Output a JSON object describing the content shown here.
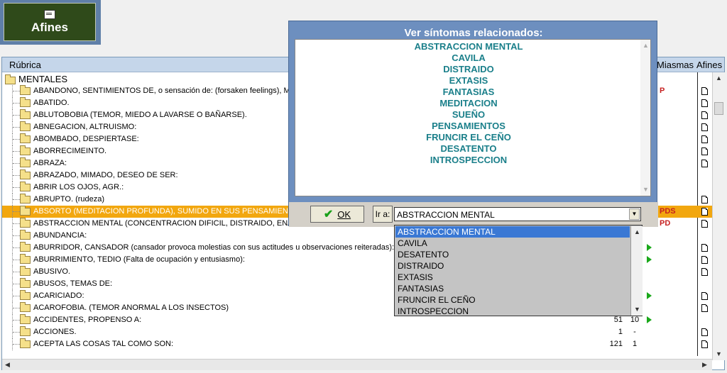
{
  "toolbar": {
    "afines_label": "Afines",
    "afines_icon": "document-icon"
  },
  "table": {
    "headers": {
      "rubrica": "Rúbrica",
      "miasmas": "Miasmas",
      "afines": "Afines"
    },
    "root": "MENTALES",
    "rows": [
      {
        "label": "ABANDONO, SENTIMIENTOS DE, o sensación de: (forsaken feelings), Mias",
        "n1": "",
        "n2": "",
        "miasma": "P",
        "doc": true,
        "arrow": false
      },
      {
        "label": "ABATIDO.",
        "n1": "",
        "n2": "",
        "miasma": "",
        "doc": true,
        "arrow": false
      },
      {
        "label": "ABLUTOBOBIA (TEMOR, MIEDO A LAVARSE O BAÑARSE).",
        "n1": "",
        "n2": "",
        "miasma": "",
        "doc": true,
        "arrow": false
      },
      {
        "label": "ABNEGACION, ALTRUISMO:",
        "n1": "",
        "n2": "",
        "miasma": "",
        "doc": true,
        "arrow": false
      },
      {
        "label": "ABOMBADO, DESPIERTASE:",
        "n1": "",
        "n2": "",
        "miasma": "",
        "doc": true,
        "arrow": false
      },
      {
        "label": "ABORRECIMEINTO.",
        "n1": "",
        "n2": "",
        "miasma": "",
        "doc": true,
        "arrow": false
      },
      {
        "label": "ABRAZA:",
        "n1": "",
        "n2": "",
        "miasma": "",
        "doc": true,
        "arrow": false
      },
      {
        "label": "ABRAZADO, MIMADO, DESEO DE SER:",
        "n1": "",
        "n2": "",
        "miasma": "",
        "doc": false,
        "arrow": false
      },
      {
        "label": "ABRIR LOS OJOS, AGR.:",
        "n1": "",
        "n2": "",
        "miasma": "",
        "doc": false,
        "arrow": false
      },
      {
        "label": "ABRUPTO. (rudeza)",
        "n1": "",
        "n2": "",
        "miasma": "",
        "doc": true,
        "arrow": false
      },
      {
        "label": "ABSORTO (MEDITACION PROFUNDA), SUMIDO EN SUS PENSAMIENTOS (b",
        "n1": "",
        "n2": "",
        "miasma": "PDS",
        "doc": true,
        "arrow": false,
        "selected": true
      },
      {
        "label": "ABSTRACCION MENTAL (CONCENTRACION DIFICIL, DISTRAIDO, ENAJENA",
        "n1": "",
        "n2": "",
        "miasma": "PD",
        "doc": true,
        "arrow": false
      },
      {
        "label": "ABUNDANCIA:",
        "n1": "",
        "n2": "",
        "miasma": "",
        "doc": false,
        "arrow": false
      },
      {
        "label": "ABURRIDOR, CANSADOR (cansador provoca molestias con sus actitudes u observaciones reiteradas):",
        "n1": "",
        "n2": "",
        "miasma": "",
        "doc": true,
        "arrow": true
      },
      {
        "label": "ABURRIMIENTO, TEDIO (Falta de ocupación y entusiasmo):",
        "n1": "",
        "n2": "",
        "miasma": "",
        "doc": true,
        "arrow": true
      },
      {
        "label": "ABUSIVO.",
        "n1": "",
        "n2": "",
        "miasma": "",
        "doc": true,
        "arrow": false
      },
      {
        "label": "ABUSOS, TEMAS DE:",
        "n1": "",
        "n2": "",
        "miasma": "",
        "doc": false,
        "arrow": false
      },
      {
        "label": "ACARICIADO:",
        "n1": "",
        "n2": "",
        "miasma": "",
        "doc": true,
        "arrow": true
      },
      {
        "label": "ACAROFOBIA. (TEMOR ANORMAL A LOS INSECTOS)",
        "n1": "",
        "n2": "",
        "miasma": "",
        "doc": true,
        "arrow": false
      },
      {
        "label": "ACCIDENTES, PROPENSO A:",
        "n1": "51",
        "n2": "10",
        "miasma": "",
        "doc": false,
        "arrow": true
      },
      {
        "label": "ACCIONES.",
        "n1": "1",
        "n2": "-",
        "miasma": "",
        "doc": true,
        "arrow": false
      },
      {
        "label": "ACEPTA LAS COSAS TAL COMO SON:",
        "n1": "121",
        "n2": "1",
        "miasma": "",
        "doc": true,
        "arrow": false
      }
    ]
  },
  "popup": {
    "title": "Ver síntomas relacionados:",
    "items": [
      "ABSTRACCION MENTAL",
      "CAVILA",
      "DISTRAIDO",
      "EXTASIS",
      "FANTASIAS",
      "MEDITACION",
      "SUEÑO",
      "PENSAMIENTOS",
      "FRUNCIR EL CEÑO",
      "DESATENTO",
      "INTROSPECCION"
    ],
    "ok_label": "OK",
    "ira_label": "Ir a:",
    "combo_value": "ABSTRACCION MENTAL"
  },
  "dropdown": {
    "options": [
      "ABSTRACCION MENTAL",
      "CAVILA",
      "DESATENTO",
      "DISTRAIDO",
      "EXTASIS",
      "FANTASIAS",
      "FRUNCIR EL CEÑO",
      "INTROSPECCION"
    ],
    "selected_index": 0
  },
  "colors": {
    "selected_row": "#f2a70f",
    "accent": "#6d8fbf",
    "item_text": "#1a7f8a",
    "miasma": "#c62020",
    "arrow": "#1aa81a"
  }
}
